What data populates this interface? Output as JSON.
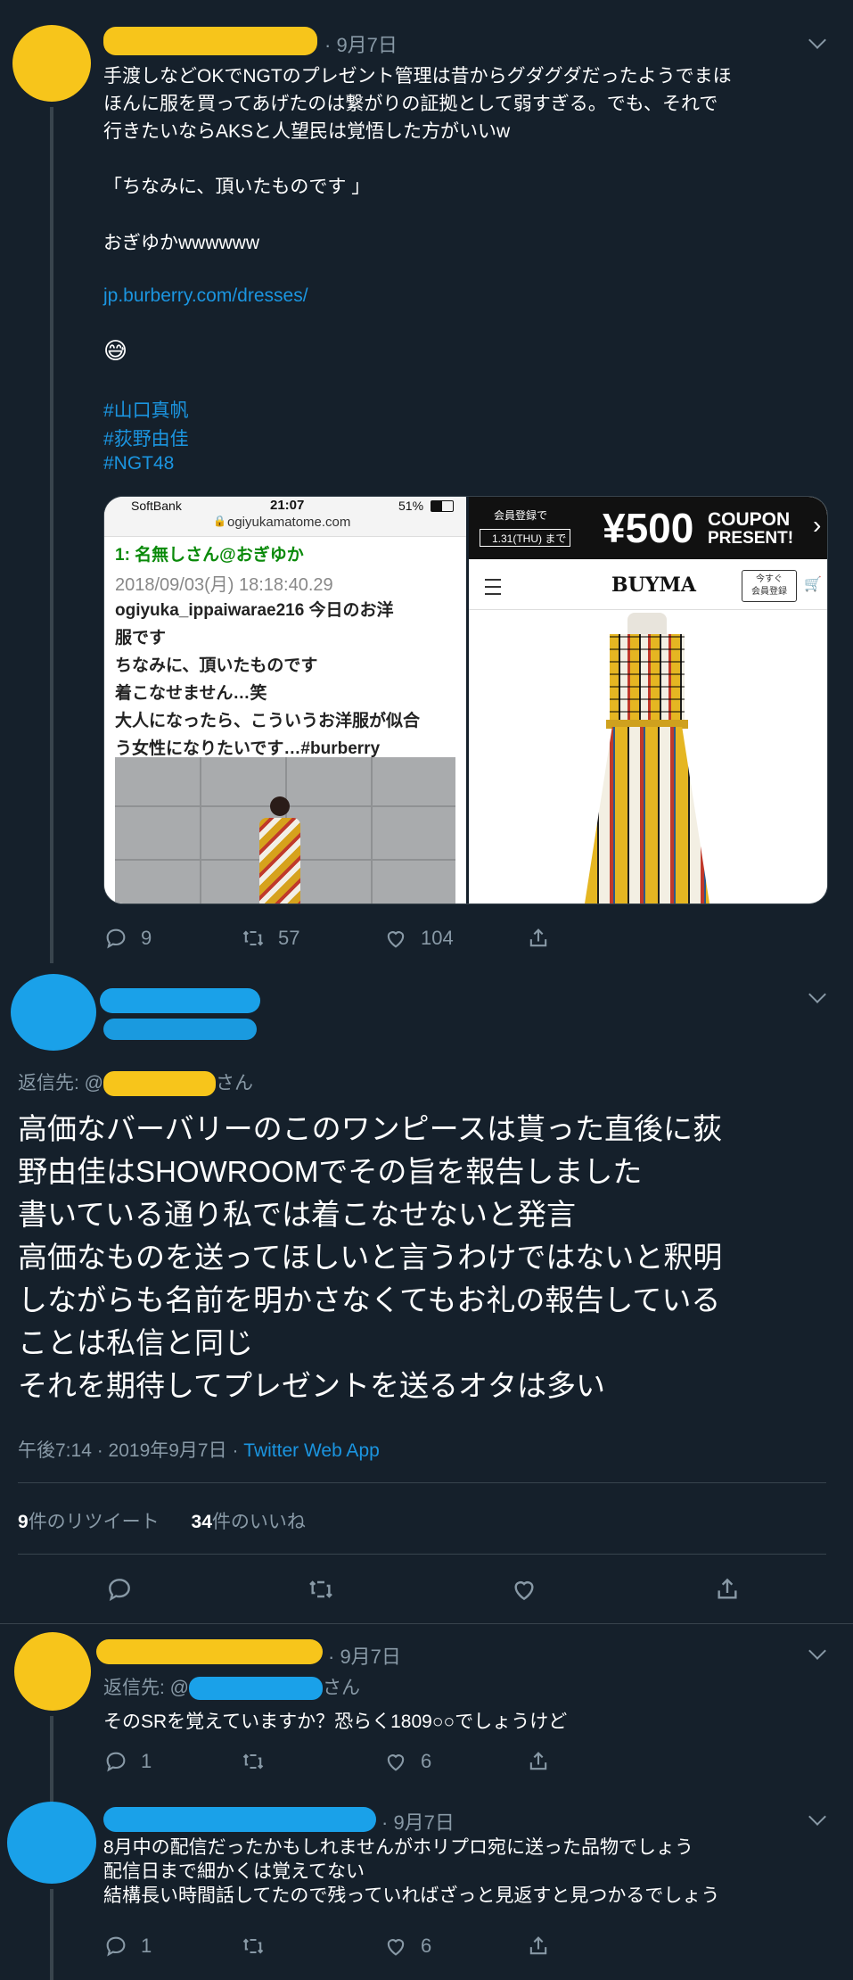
{
  "tweet1": {
    "date": "· 9月7日",
    "lines": [
      "手渡しなどOKでNGTのプレゼント管理は昔からグダグダだったようでまほ",
      "ほんに服を買ってあげたのは繋がりの証拠として弱すぎる。でも、それで",
      "行きたいならAKSと人望民は覚悟した方がいいw"
    ],
    "quote": "「ちなみに、頂いたものです 」",
    "laugh": "おぎゆかwwwwww",
    "url": "jp.burberry.com/dresses/",
    "emoji": "😅",
    "hashtags": [
      "#山口真帆",
      "#荻野由佳",
      "#NGT48"
    ],
    "actions": {
      "replies": "9",
      "retweets": "57",
      "likes": "104"
    }
  },
  "media": {
    "left": {
      "status_carrier": "SoftBank",
      "status_time": "21:07",
      "status_battery": "51%",
      "address": "ogiyukamatome.com",
      "post_header": "1: 名無しさん@おぎゆか",
      "post_date": "2018/09/03(月) 18:18:40.29",
      "post_lines": [
        "ogiyuka_ippaiwarae216 今日のお洋",
        "服です",
        "ちなみに、頂いたものです",
        "着こなせません…笑",
        "大人になったら、こういうお洋服が似合",
        "う女性になりたいです…#burberry"
      ]
    },
    "right": {
      "banner_small": "会員登録で",
      "banner_date": "1.31(THU) まで",
      "banner_price": "¥500",
      "banner_coupon": "COUPON",
      "banner_present": "PRESENT!",
      "brand": "BUYMA",
      "register_btn_1": "今すぐ",
      "register_btn_2": "会員登録"
    }
  },
  "main_tweet": {
    "reply_prefix": "返信先: @",
    "reply_suffix": "さん",
    "lines": [
      "高価なバーバリーのこのワンピースは貰った直後に荻",
      "野由佳はSHOWROOMでその旨を報告しました",
      "書いている通り私では着こなせないと発言",
      "高価なものを送ってほしいと言うわけではないと釈明",
      "しながらも名前を明かさなくてもお礼の報告している",
      "ことは私信と同じ",
      "それを期待してプレゼントを送るオタは多い"
    ],
    "timestamp": "午後7:14 · 2019年9月7日 · ",
    "client": "Twitter Web App",
    "retweet_count": "9",
    "retweet_label": "件のリツイート",
    "like_count": "34",
    "like_label": "件のいいね"
  },
  "reply1": {
    "date": "· 9月7日",
    "reply_prefix": "返信先: @",
    "reply_suffix": "さん",
    "text": "そのSRを覚えていますか？恐らく1809○○でしょうけど",
    "actions": {
      "replies": "1",
      "likes": "6"
    }
  },
  "reply2": {
    "date": "· 9月7日",
    "lines": [
      "8月中の配信だったかもしれませんがホリプロ宛に送った品物でしょう",
      "配信日まで細かくは覚えてない",
      "結構長い時間話してたので残っていればざっと見返すと見つかるでしょう"
    ],
    "actions": {
      "replies": "1",
      "likes": "6"
    }
  },
  "colors": {
    "background": "#15202b",
    "muted": "#8899a6",
    "link": "#1b95e0",
    "redaction_yellow": "#f7c51b",
    "redaction_blue": "#1aa1e9"
  }
}
